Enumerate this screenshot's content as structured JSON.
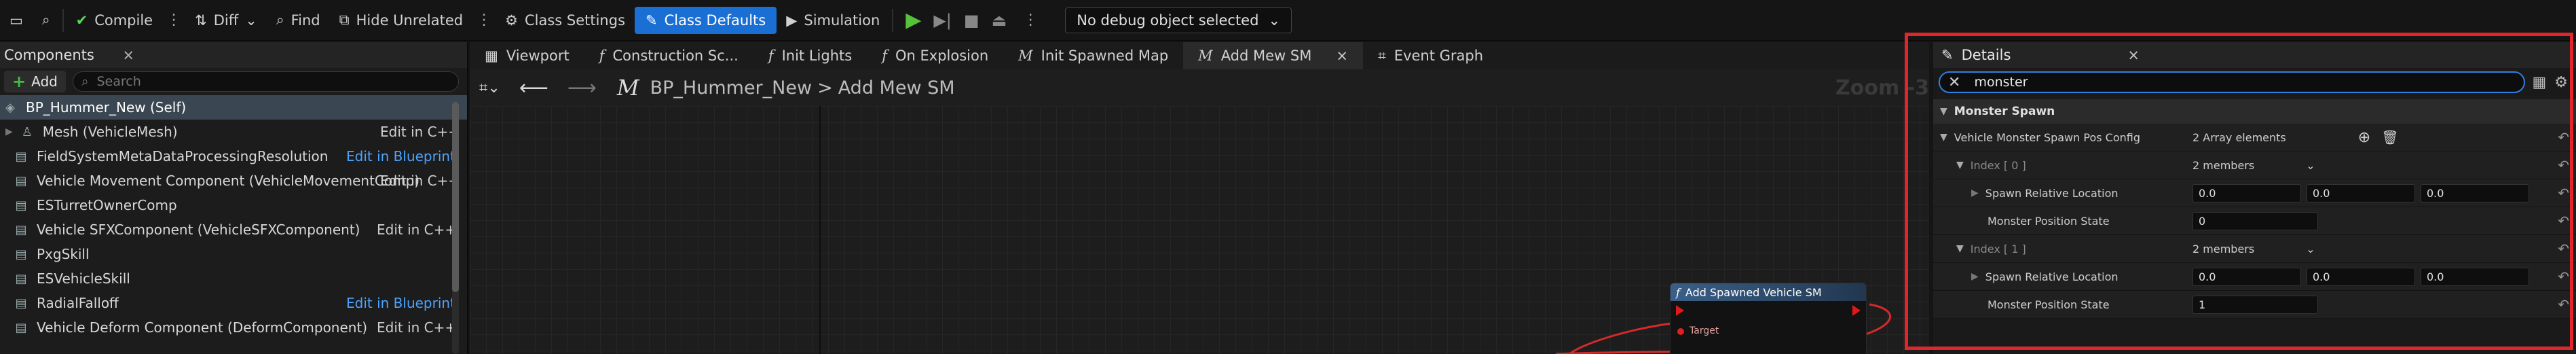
{
  "toolbar": {
    "compile_label": "Compile",
    "diff_label": "Diff",
    "find_label": "Find",
    "hide_unrelated_label": "Hide Unrelated",
    "class_settings_label": "Class Settings",
    "class_defaults_label": "Class Defaults",
    "simulation_label": "Simulation",
    "debug_object_label": "No debug object selected"
  },
  "components": {
    "tab_label": "Components",
    "add_label": "Add",
    "search_placeholder": "Search",
    "root_item": "BP_Hummer_New (Self)",
    "items": [
      {
        "label": "Mesh (VehicleMesh)",
        "action": "Edit in C++"
      },
      {
        "label": "FieldSystemMetaDataProcessingResolution",
        "action": "Edit in Blueprint"
      },
      {
        "label": "Vehicle Movement Component (VehicleMovementComp)",
        "action": "Edit in C++"
      },
      {
        "label": "ESTurretOwnerComp",
        "action": ""
      },
      {
        "label": "Vehicle SFXComponent (VehicleSFXComponent)",
        "action": "Edit in C++"
      },
      {
        "label": "PxgSkill",
        "action": ""
      },
      {
        "label": "ESVehicleSkill",
        "action": ""
      },
      {
        "label": "RadialFalloff",
        "action": "Edit in Blueprint"
      },
      {
        "label": "Vehicle Deform Component (DeformComponent)",
        "action": "Edit in C++"
      }
    ]
  },
  "editor_tabs": [
    {
      "label": "Viewport"
    },
    {
      "label": "Construction Sc..."
    },
    {
      "label": "Init Lights"
    },
    {
      "label": "On Explosion"
    },
    {
      "label": "Init Spawned Map"
    },
    {
      "label": "Add Mew SM"
    },
    {
      "label": "Event Graph"
    }
  ],
  "breadcrumb": {
    "blueprint": "BP_Hummer_New",
    "separator": ">",
    "function": "Add Mew SM",
    "zoom": "Zoom -3"
  },
  "graph_node": {
    "title": "Add Spawned Vehicle SM",
    "pin_target": "Target"
  },
  "details": {
    "tab_label": "Details",
    "search_value": "monster",
    "category": "Monster Spawn",
    "array_name": "Vehicle Monster Spawn Pos Config",
    "array_count": "2 Array elements",
    "elements": [
      {
        "index_label": "Index [ 0 ]",
        "members": "2 members",
        "location_label": "Spawn Relative Location",
        "location": [
          "0.0",
          "0.0",
          "0.0"
        ],
        "state_label": "Monster Position State",
        "state": "0"
      },
      {
        "index_label": "Index [ 1 ]",
        "members": "2 members",
        "location_label": "Spawn Relative Location",
        "location": [
          "0.0",
          "0.0",
          "0.0"
        ],
        "state_label": "Monster Position State",
        "state": "1"
      }
    ]
  },
  "colors": {
    "accent_blue": "#1a6fd4",
    "highlight_red": "#e0262a",
    "play_green": "#55c23a",
    "link_blue": "#4da3ff"
  }
}
